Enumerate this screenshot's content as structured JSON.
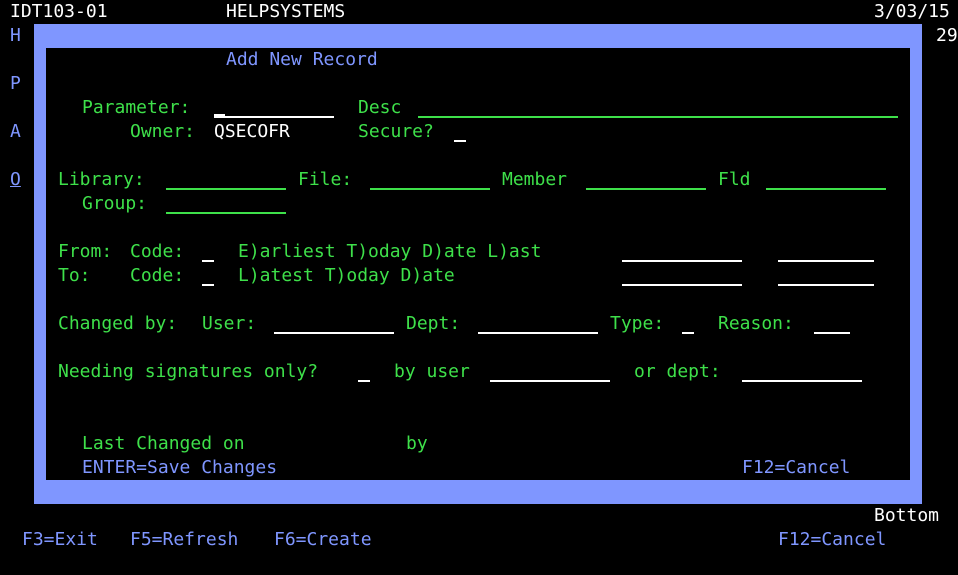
{
  "header": {
    "screen_id": "IDT103-01",
    "vendor": "HELPSYSTEMS",
    "date": "3/03/15",
    "page_number": "29"
  },
  "side_letters": [
    "H",
    "P",
    "A",
    "O"
  ],
  "window": {
    "title": "Add New Record",
    "parameter_label": "Parameter:",
    "desc_label": "Desc",
    "owner_label": "Owner:",
    "owner_value": "QSECOFR",
    "secure_label": "Secure?",
    "library_label": "Library:",
    "file_label": "File:",
    "member_label": "Member",
    "fld_label": "Fld",
    "group_label": "Group:",
    "from_label": "From:",
    "from_code_label": "Code:",
    "from_options": "E)arliest T)oday D)ate L)ast",
    "to_label": "To:",
    "to_code_label": "Code:",
    "to_options": "L)atest T)oday D)ate",
    "changed_by_label": "Changed by:",
    "user_label": "User:",
    "dept_label": "Dept:",
    "type_label": "Type:",
    "reason_label": "Reason:",
    "needing_label": "Needing signatures only?",
    "by_user_label": "by user",
    "or_dept_label": "or dept:",
    "last_changed_label": "Last Changed on",
    "by_label": "by",
    "enter_key": "ENTER=Save Changes",
    "f12_window": "F12=Cancel"
  },
  "bottom_indicator": "Bottom",
  "function_keys": {
    "f3": "F3=Exit",
    "f5": "F5=Refresh",
    "f6": "F6=Create",
    "f12": "F12=Cancel"
  },
  "colors": {
    "green": "#3ee04a",
    "blue": "#7f96ff",
    "white": "#ffffff",
    "background": "#000000"
  }
}
